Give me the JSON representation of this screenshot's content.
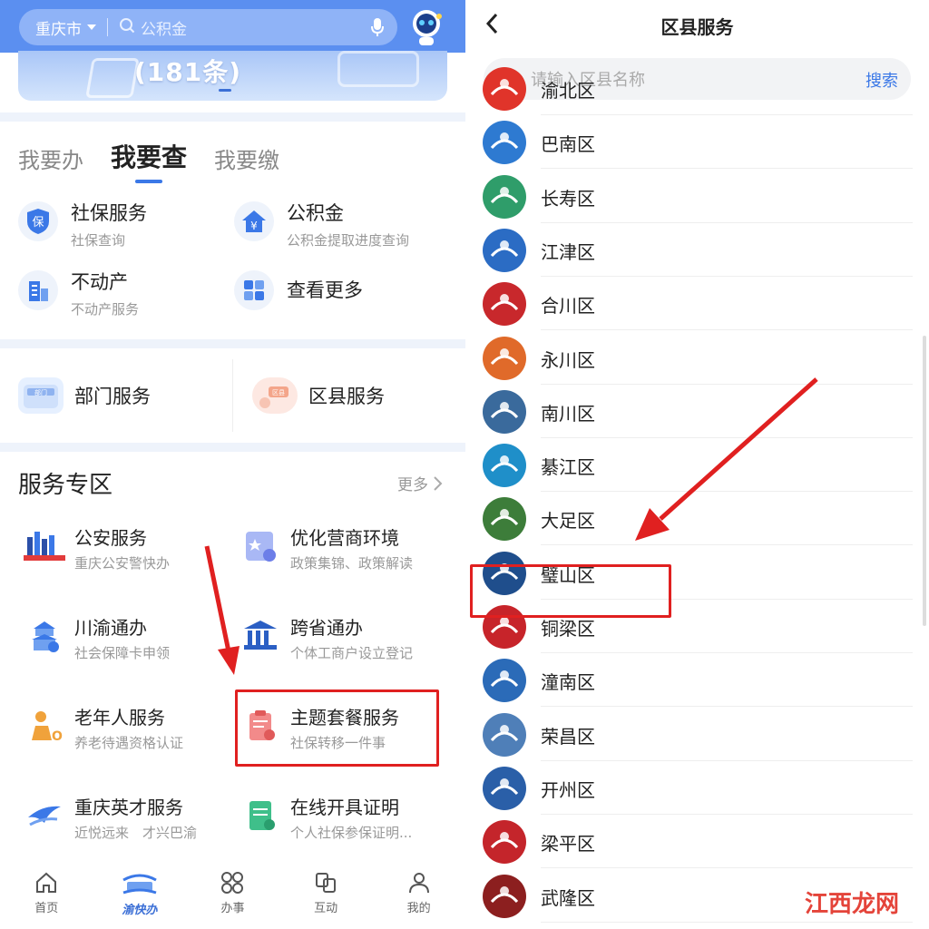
{
  "left": {
    "search": {
      "city": "重庆市",
      "placeholder": "公积金"
    },
    "banner": {
      "text": "(181条)"
    },
    "tabs": [
      {
        "label": "我要办"
      },
      {
        "label": "我要查"
      },
      {
        "label": "我要缴"
      }
    ],
    "active_tab": "我要查",
    "services": [
      {
        "title": "社保服务",
        "sub": "社保查询",
        "icon": "shield-icon",
        "color": "#3b78e7"
      },
      {
        "title": "公积金",
        "sub": "公积金提取进度查询",
        "icon": "house-yuan-icon",
        "color": "#3b78e7"
      },
      {
        "title": "不动产",
        "sub": "不动产服务",
        "icon": "building-icon",
        "color": "#3b78e7"
      },
      {
        "title": "查看更多",
        "sub": "",
        "icon": "grid-icon",
        "color": "#3b78e7"
      }
    ],
    "entries": [
      {
        "label": "部门服务"
      },
      {
        "label": "区县服务"
      }
    ],
    "zone": {
      "title": "服务专区",
      "more": "更多",
      "items": [
        {
          "title": "公安服务",
          "sub": "重庆公安警快办"
        },
        {
          "title": "优化营商环境",
          "sub": "政策集锦、政策解读"
        },
        {
          "title": "川渝通办",
          "sub": "社会保障卡申领"
        },
        {
          "title": "跨省通办",
          "sub": "个体工商户设立登记"
        },
        {
          "title": "老年人服务",
          "sub": "养老待遇资格认证"
        },
        {
          "title": "主题套餐服务",
          "sub": "社保转移一件事"
        },
        {
          "title": "重庆英才服务",
          "sub": "近悦远来　才兴巴渝"
        },
        {
          "title": "在线开具证明",
          "sub": "个人社保参保证明..."
        }
      ]
    },
    "nav": [
      {
        "label": "首页"
      },
      {
        "label": "渝快办"
      },
      {
        "label": "办事"
      },
      {
        "label": "互动"
      },
      {
        "label": "我的"
      }
    ]
  },
  "right": {
    "title": "区县服务",
    "search": {
      "placeholder": "请输入区县名称",
      "button": "搜索"
    },
    "districts": [
      {
        "name": "渝北区",
        "color": "#e0342a"
      },
      {
        "name": "巴南区",
        "color": "#2e7ad1"
      },
      {
        "name": "长寿区",
        "color": "#2f9d6a"
      },
      {
        "name": "江津区",
        "color": "#2b6cc4"
      },
      {
        "name": "合川区",
        "color": "#c8282c"
      },
      {
        "name": "永川区",
        "color": "#e06a2a"
      },
      {
        "name": "南川区",
        "color": "#3a6a9c"
      },
      {
        "name": "綦江区",
        "color": "#1f8fc9"
      },
      {
        "name": "大足区",
        "color": "#3d7d3a"
      },
      {
        "name": "璧山区",
        "color": "#1f4e8c"
      },
      {
        "name": "铜梁区",
        "color": "#c7242a"
      },
      {
        "name": "潼南区",
        "color": "#2b6bb8"
      },
      {
        "name": "荣昌区",
        "color": "#4f7fb8"
      },
      {
        "name": "开州区",
        "color": "#2a5fa8"
      },
      {
        "name": "梁平区",
        "color": "#c4252b"
      },
      {
        "name": "武隆区",
        "color": "#8c1f1f"
      }
    ]
  },
  "watermark": "江西龙网",
  "colors": {
    "primary": "#3b78e7",
    "highlight": "#e02020"
  }
}
